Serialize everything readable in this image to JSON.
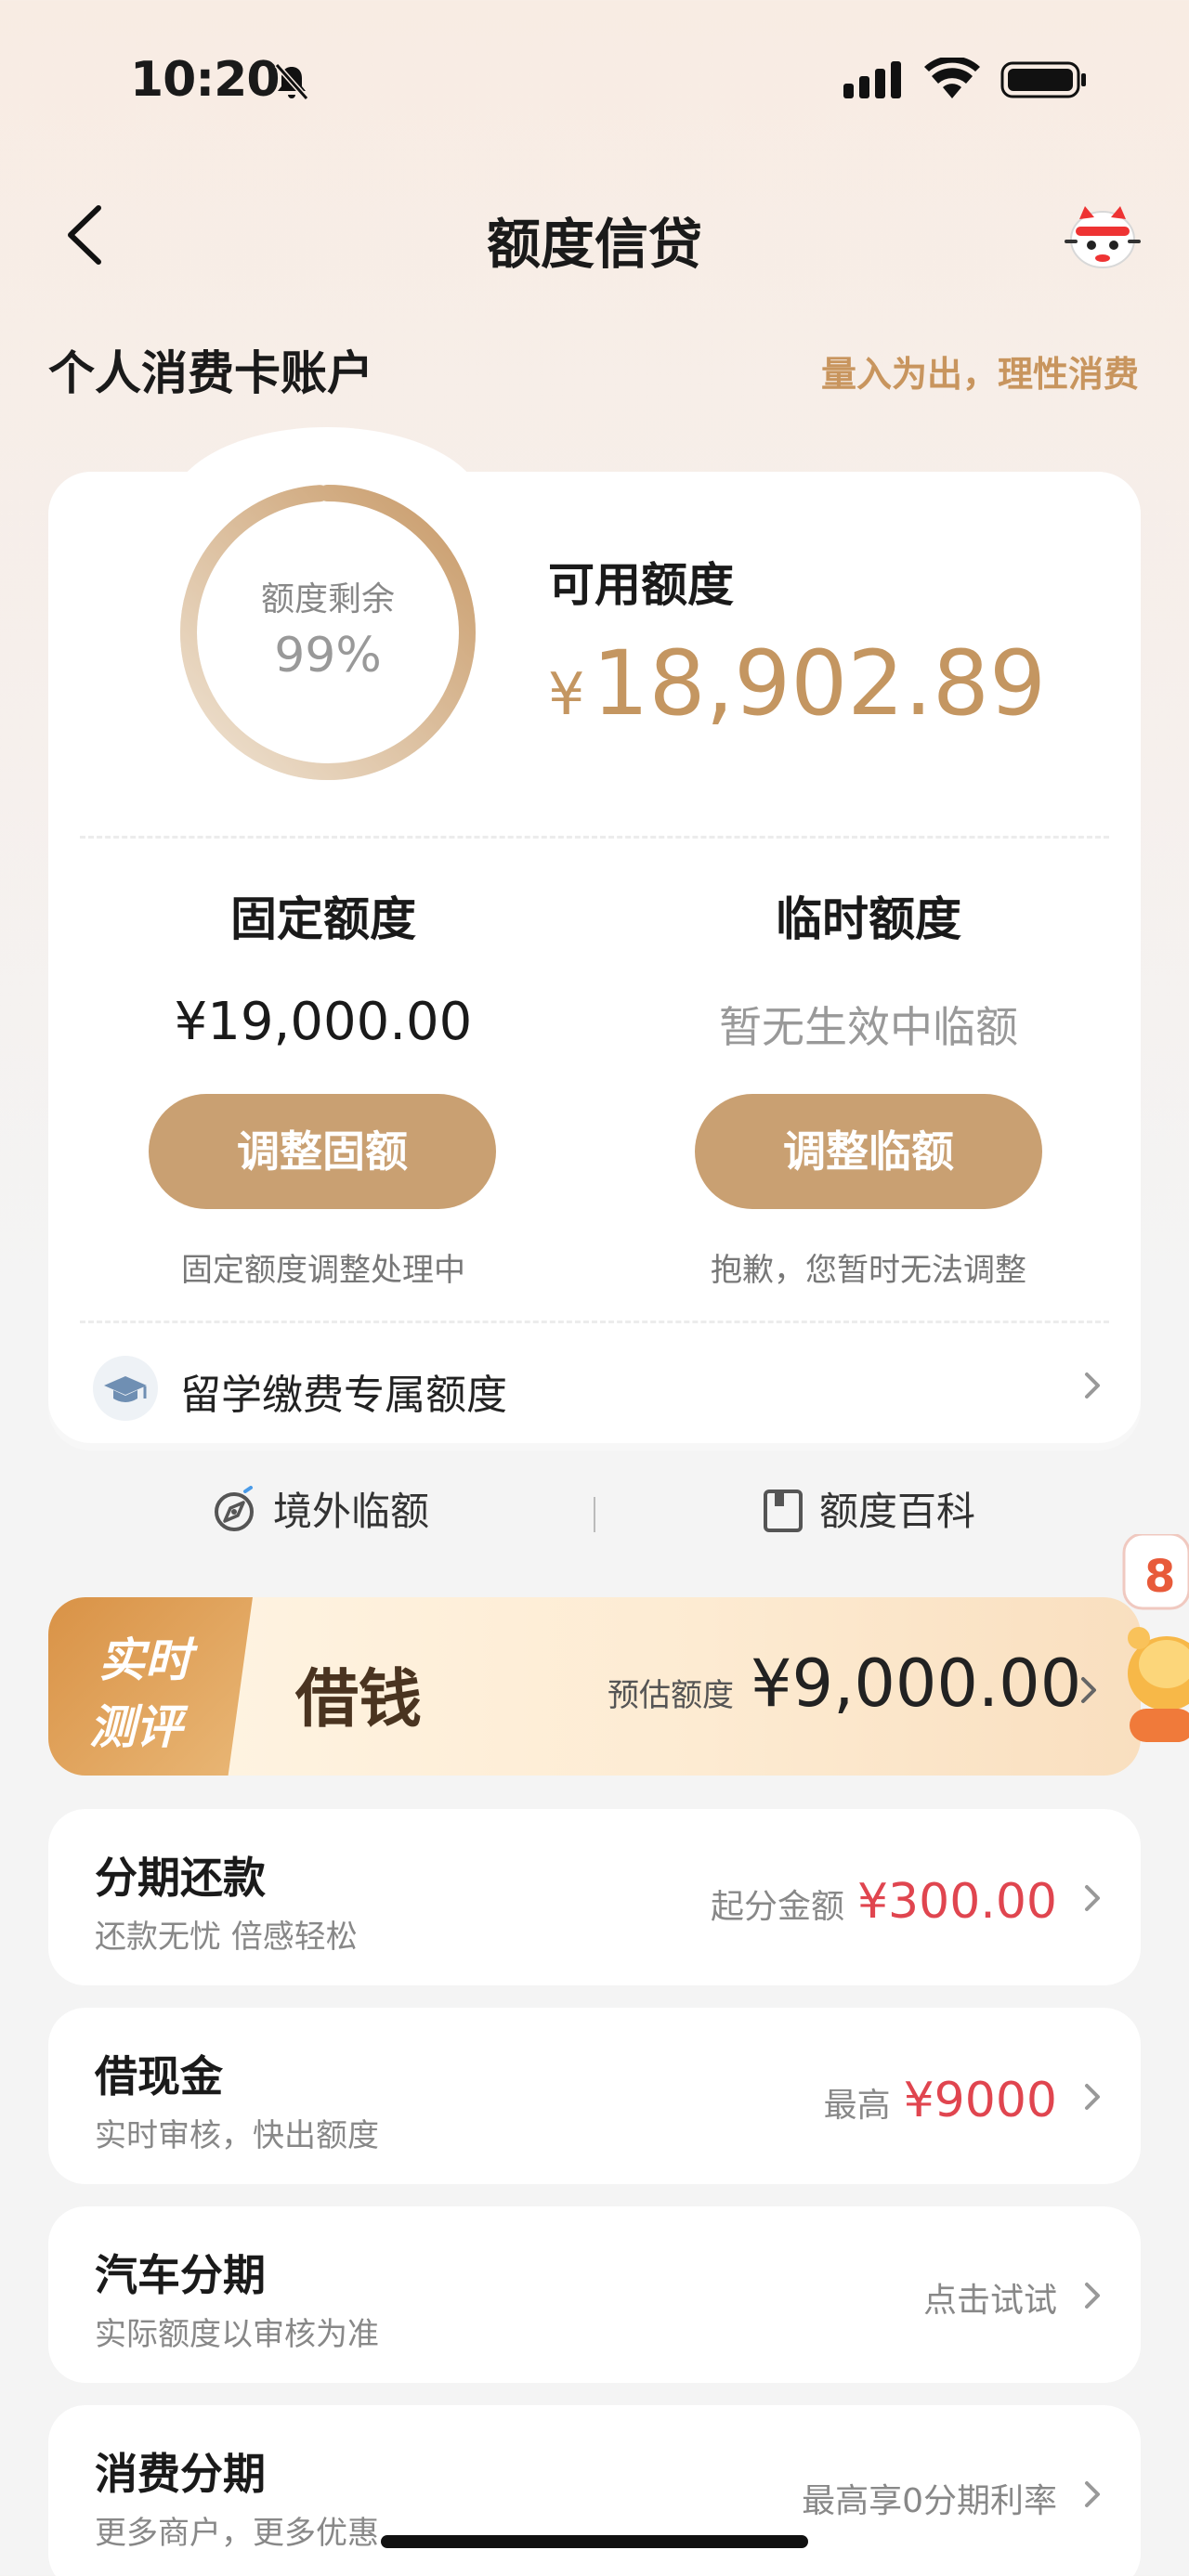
{
  "status": {
    "time": "10:20"
  },
  "header": {
    "title": "额度信贷"
  },
  "account": {
    "title": "个人消费卡账户",
    "slogan": "量入为出，理性消费"
  },
  "quota": {
    "ring_label": "额度剩余",
    "ring_percent": "99%",
    "ring_fraction": 0.99,
    "available_label": "可用额度",
    "available_currency": "¥",
    "available_amount": "18,902.89"
  },
  "fixed": {
    "title": "固定额度",
    "amount": "¥19,000.00",
    "button": "调整固额",
    "note": "固定额度调整处理中"
  },
  "temp": {
    "title": "临时额度",
    "status": "暂无生效中临额",
    "button": "调整临额",
    "note": "抱歉，您暂时无法调整"
  },
  "study": {
    "label": "留学缴费专属额度"
  },
  "links": {
    "overseas": "境外临额",
    "wiki": "额度百科"
  },
  "banner": {
    "tag_line1": "实时",
    "tag_line2": "测评",
    "title": "借钱",
    "est_label": "预估额度",
    "est_amount": "¥9,000.00",
    "badge_partial": "8"
  },
  "rows": [
    {
      "title": "分期还款",
      "sub": "还款无忧 倍感轻松",
      "right_label": "起分金额",
      "right_value": "¥300.00"
    },
    {
      "title": "借现金",
      "sub": "实时审核，快出额度",
      "right_label": "最高",
      "right_value": "¥9000"
    },
    {
      "title": "汽车分期",
      "sub": "实际额度以审核为准",
      "right_label": "点击试试",
      "right_value": ""
    },
    {
      "title": "消费分期",
      "sub": "更多商户，更多优惠",
      "right_label": "最高享0分期利率",
      "right_value": ""
    }
  ],
  "colors": {
    "gold": "#c9a072",
    "gold_text": "#c49661",
    "red": "#e0454f",
    "slogan": "#c8955e"
  }
}
